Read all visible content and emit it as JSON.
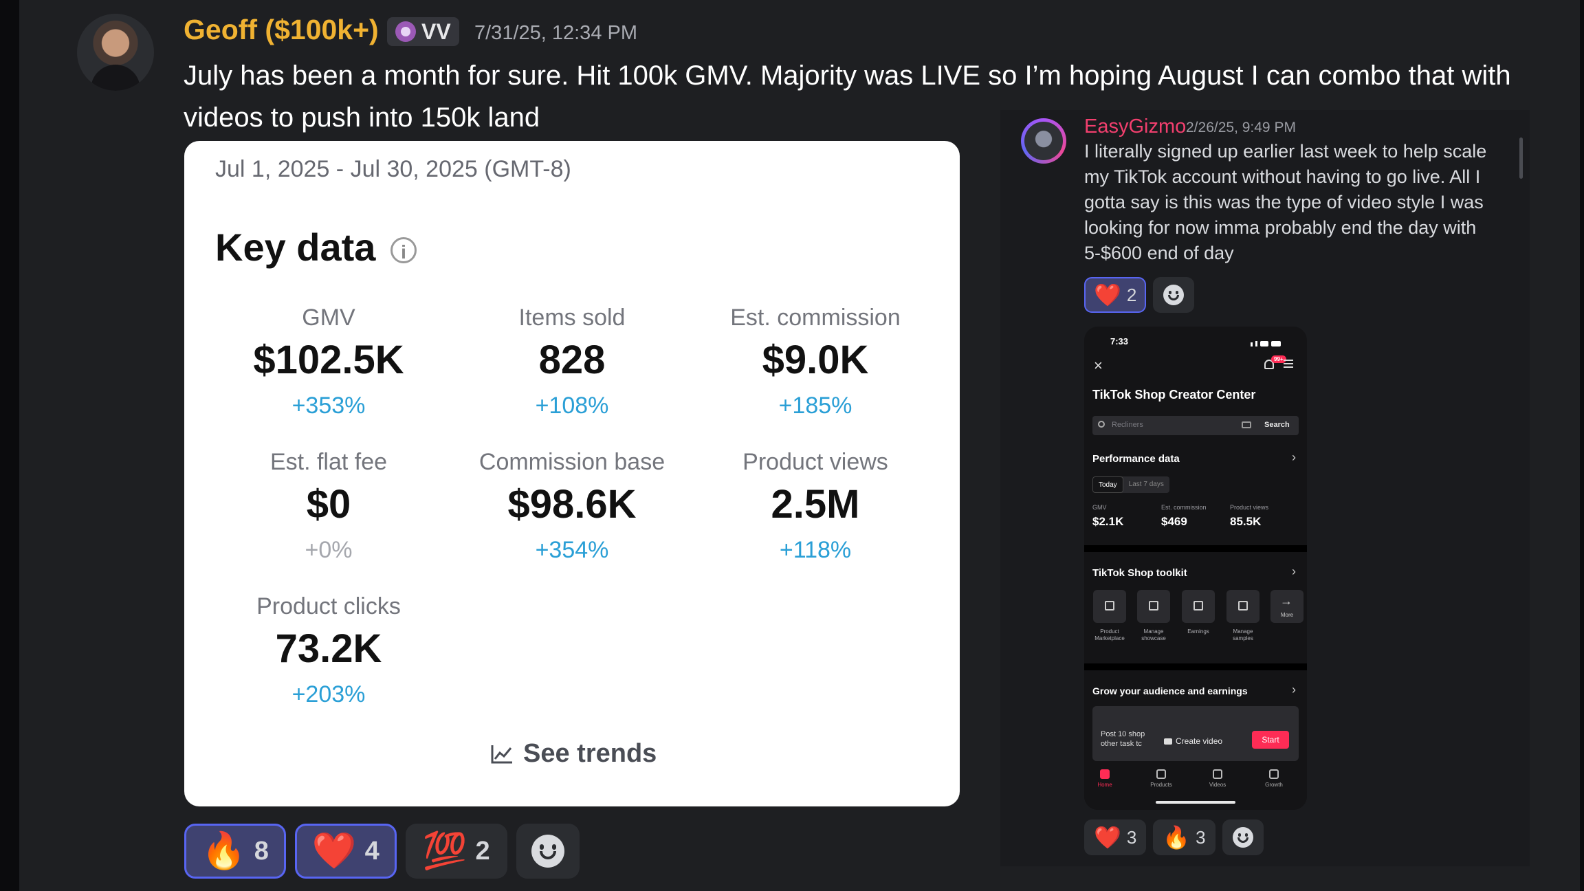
{
  "message": {
    "author": "Geoff ($100k+)",
    "badge": "VV",
    "timestamp": "7/31/25, 12:34 PM",
    "text": "July has been a month for sure. Hit 100k GMV. Majority was LIVE so I’m hoping August I can combo that with videos to push into 150k land"
  },
  "card": {
    "date_range": "Jul 1, 2025 - Jul 30, 2025 (GMT-8)",
    "title": "Key data",
    "info_icon": "i",
    "metrics": [
      {
        "label": "GMV",
        "value": "$102.5K",
        "change": "+353%"
      },
      {
        "label": "Items sold",
        "value": "828",
        "change": "+108%"
      },
      {
        "label": "Est. commission",
        "value": "$9.0K",
        "change": "+185%"
      },
      {
        "label": "Est. flat fee",
        "value": "$0",
        "change": "+0%"
      },
      {
        "label": "Commission base",
        "value": "$98.6K",
        "change": "+354%"
      },
      {
        "label": "Product views",
        "value": "2.5M",
        "change": "+118%"
      },
      {
        "label": "Product clicks",
        "value": "73.2K",
        "change": "+203%"
      }
    ],
    "see_trends": "See trends"
  },
  "reactions": [
    {
      "emoji": "🔥",
      "count": "8",
      "active": true
    },
    {
      "emoji": "❤️",
      "count": "4",
      "active": true
    },
    {
      "emoji": "💯",
      "count": "2",
      "active": false
    }
  ],
  "side_message": {
    "author": "EasyGizmo",
    "timestamp": "2/26/25, 9:49 PM",
    "text": "I literally signed up earlier last week to help scale my TikTok account without having to go live. All I gotta say is this was the type of video style I was looking for now imma probably end the day with 5-$600 end of day",
    "reactions": [
      {
        "emoji": "❤️",
        "count": "2",
        "active": true
      }
    ],
    "bottom_reactions": [
      {
        "emoji": "❤️",
        "count": "3"
      },
      {
        "emoji": "🔥",
        "count": "3"
      }
    ]
  },
  "phone": {
    "time": "7:33",
    "notif_badge": "99+",
    "close": "×",
    "title": "TikTok Shop Creator Center",
    "search_placeholder": "Recliners",
    "search_button": "Search",
    "performance_title": "Performance data",
    "chevron": "›",
    "tabs": [
      "Today",
      "Last 7 days"
    ],
    "stats": [
      {
        "label": "GMV",
        "value": "$2.1K"
      },
      {
        "label": "Est. commission",
        "value": "$469"
      },
      {
        "label": "Product views",
        "value": "85.5K"
      }
    ],
    "toolkit_title": "TikTok Shop toolkit",
    "tools": [
      "Product Marketplace",
      "Manage showcase",
      "Earnings",
      "Manage samples"
    ],
    "more_arrow": "→",
    "more_label": "More",
    "grow_title": "Grow your audience and earnings",
    "grow_text": "Post 10 shop other task tc",
    "create_video": "Create video",
    "start": "Start",
    "nav": [
      "Home",
      "Products",
      "Videos",
      "Growth"
    ]
  }
}
